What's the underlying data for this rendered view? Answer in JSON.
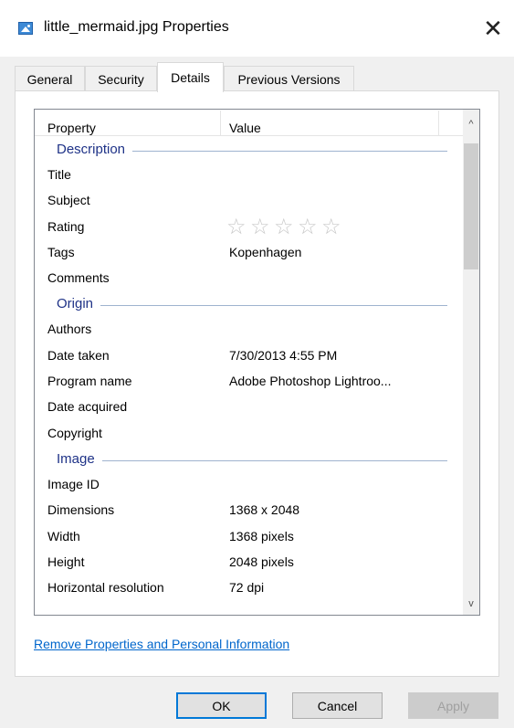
{
  "window": {
    "title": "little_mermaid.jpg Properties",
    "close_glyph": "✕"
  },
  "tabs": [
    {
      "label": "General"
    },
    {
      "label": "Security"
    },
    {
      "label": "Details"
    },
    {
      "label": "Previous Versions"
    }
  ],
  "columns": {
    "property": "Property",
    "value": "Value"
  },
  "groups": {
    "description": {
      "label": "Description",
      "title": "Title",
      "subject": "Subject",
      "rating": "Rating",
      "rating_value": 0,
      "rating_max": 5,
      "tags": "Tags",
      "tags_value": "Kopenhagen",
      "comments": "Comments"
    },
    "origin": {
      "label": "Origin",
      "authors": "Authors",
      "date_taken": "Date taken",
      "date_taken_value": "7/30/2013 4:55 PM",
      "program_name": "Program name",
      "program_name_value": "Adobe Photoshop Lightroo...",
      "date_acquired": "Date acquired",
      "copyright": "Copyright"
    },
    "image": {
      "label": "Image",
      "image_id": "Image ID",
      "dimensions": "Dimensions",
      "dimensions_value": "1368 x 2048",
      "width": "Width",
      "width_value": "1368 pixels",
      "height": "Height",
      "height_value": "2048 pixels",
      "hres": "Horizontal resolution",
      "hres_value": "72 dpi"
    }
  },
  "link": "Remove Properties and Personal Information",
  "buttons": {
    "ok": "OK",
    "cancel": "Cancel",
    "apply": "Apply"
  },
  "scrollbar": {
    "up": "^",
    "down": "v"
  },
  "colors": {
    "accent": "#0078d7",
    "group": "#1e3287",
    "link": "#0066cc"
  }
}
